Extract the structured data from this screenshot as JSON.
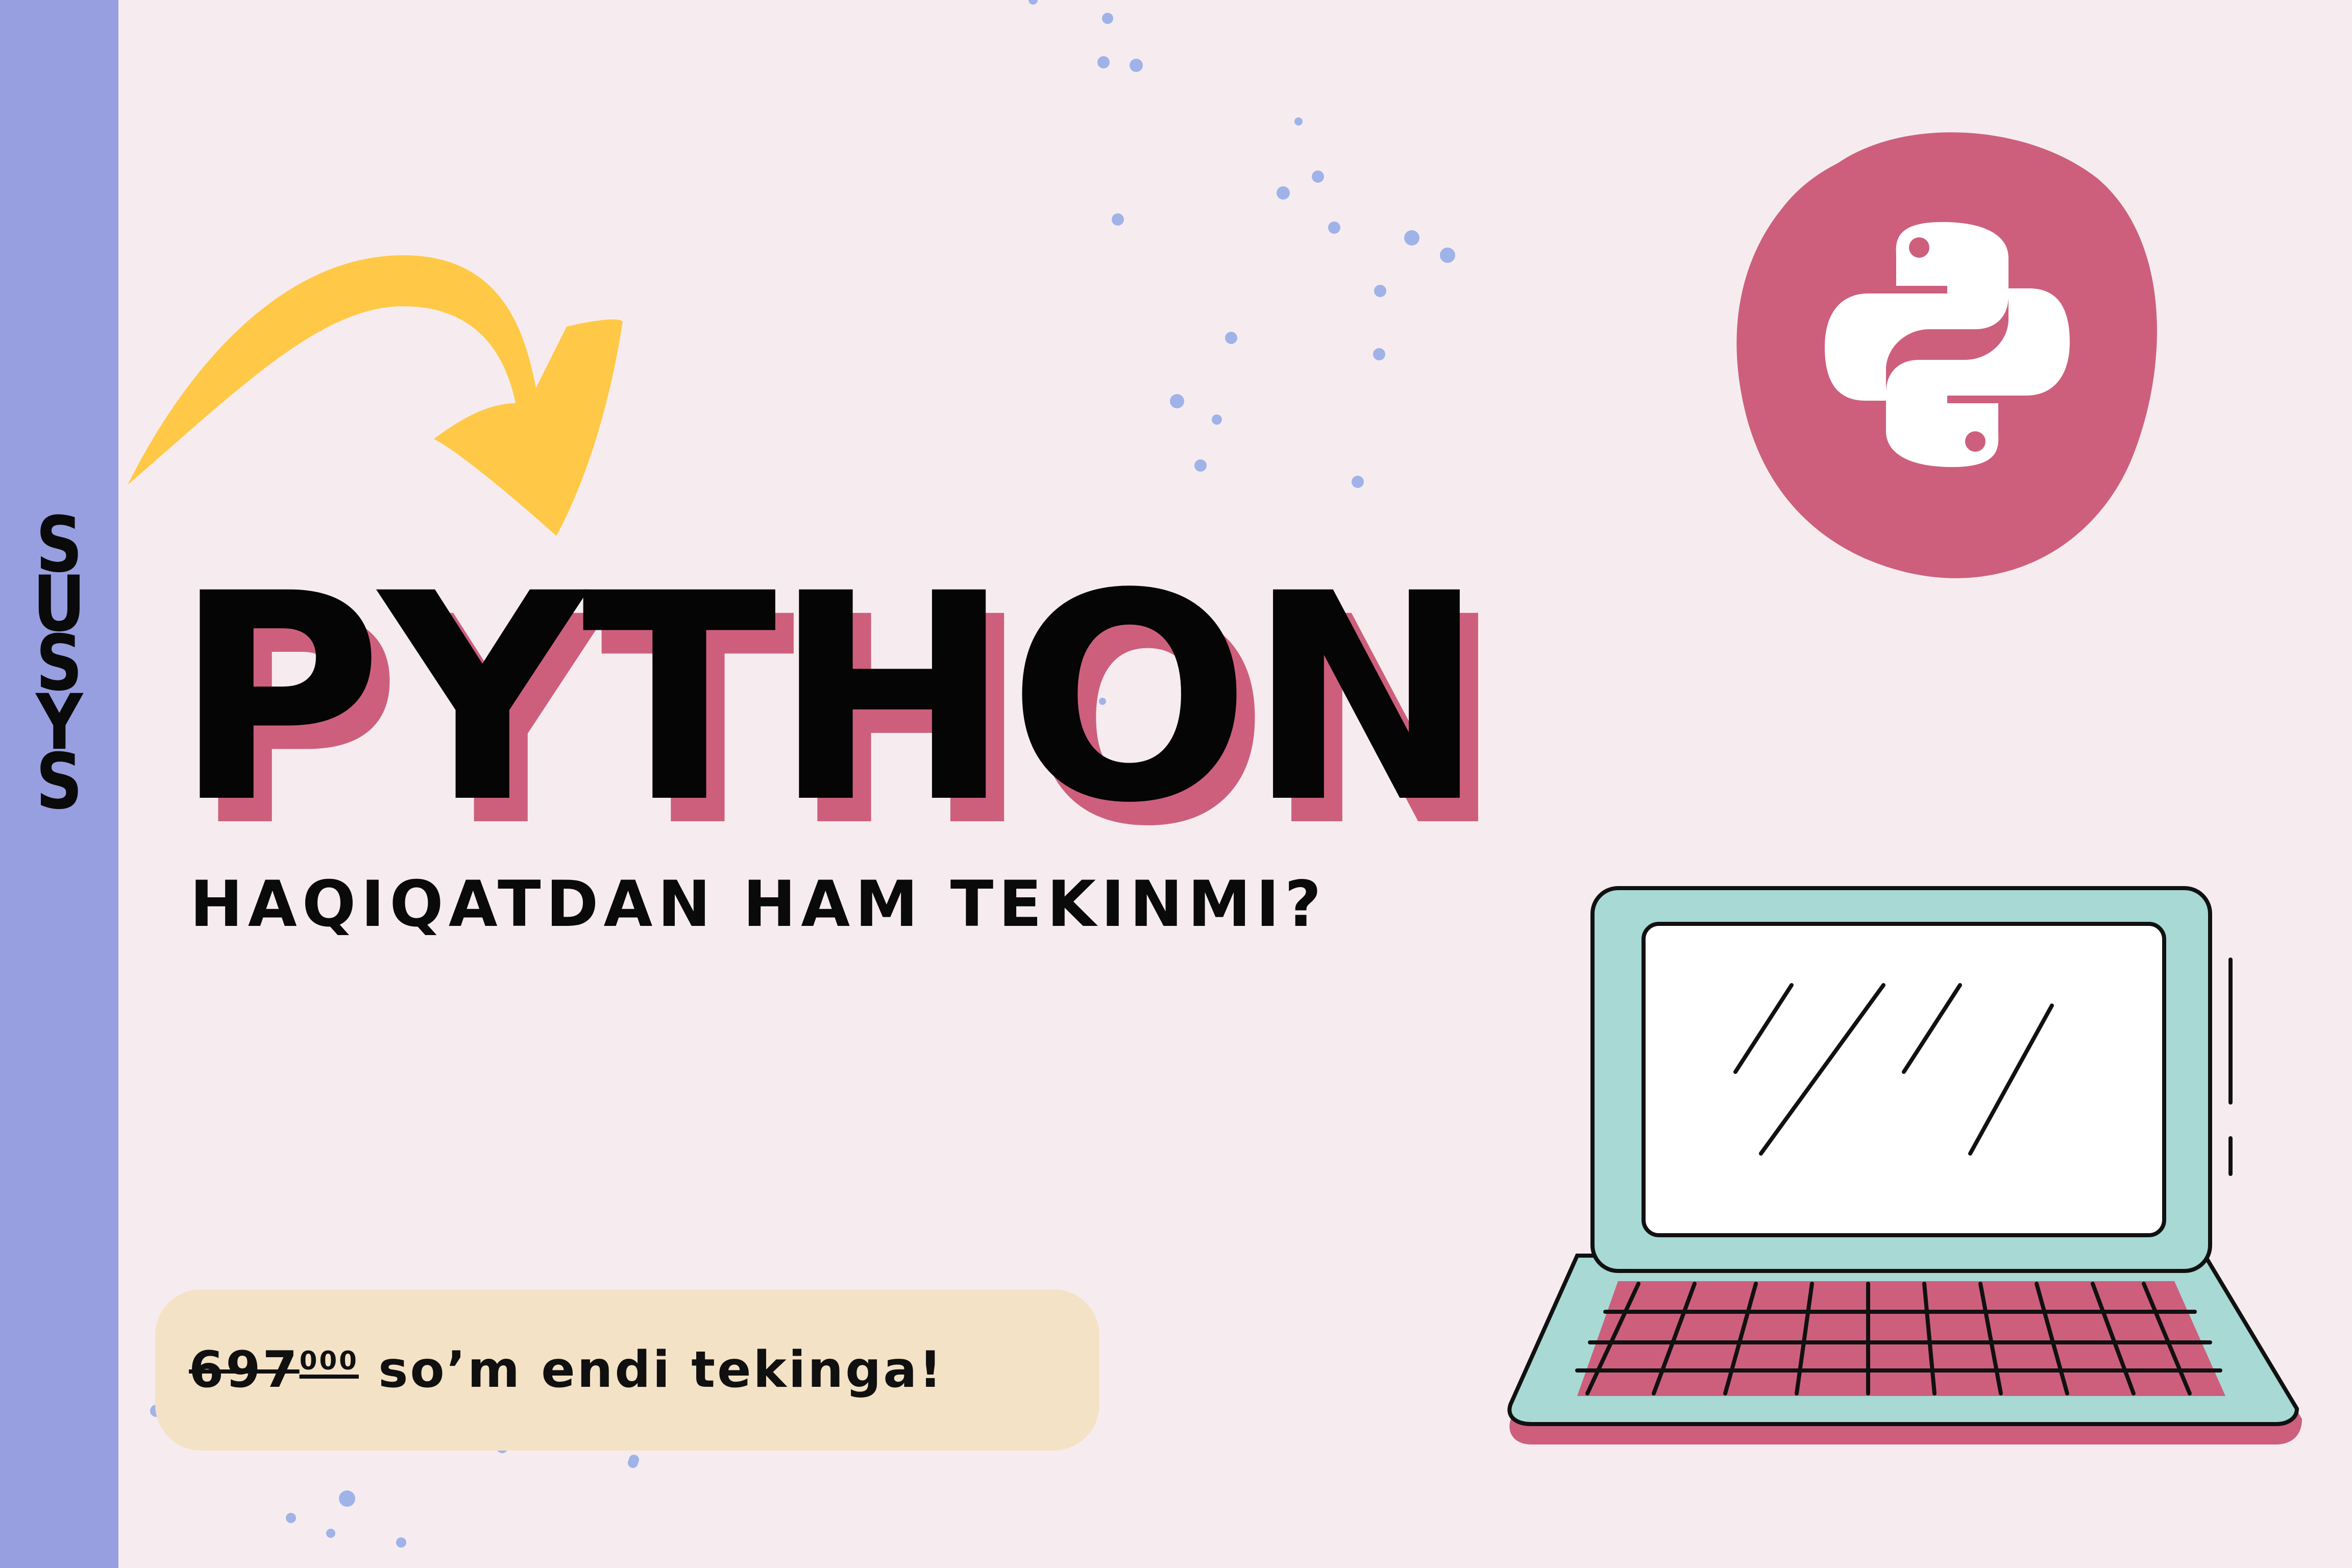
{
  "brand": {
    "letters": [
      "S",
      "U",
      "S",
      "Y",
      "S"
    ]
  },
  "headline": {
    "title": "PYTHON",
    "subtitle": "HAQIQATDAN HAM TEKINMI?"
  },
  "promo": {
    "old_price": "697",
    "old_price_suffix": "000",
    "text": " so’m endi tekinga!"
  },
  "colors": {
    "sidebar": "#979fe0",
    "background": "#f6ecef",
    "accent_pink": "#cd5f7d",
    "arrow_yellow": "#ffc947",
    "laptop_teal": "#a8d9d4",
    "promo_bg": "#f4e2c6"
  },
  "icons": [
    "arrow-icon",
    "python-logo-icon",
    "laptop-icon"
  ]
}
